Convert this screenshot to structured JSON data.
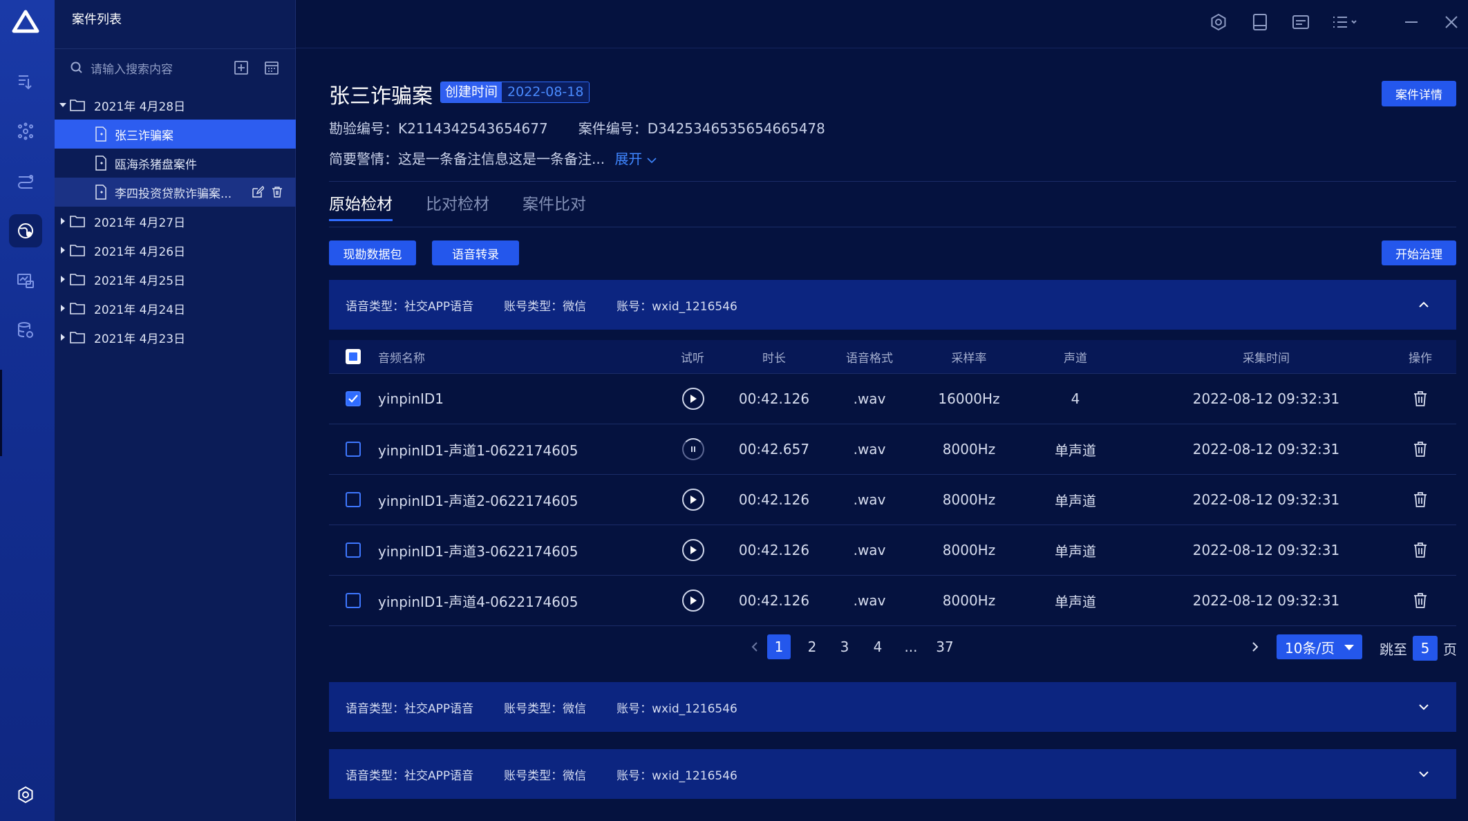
{
  "app": {
    "panel_title": "案件列表",
    "search_placeholder": "请输入搜索内容"
  },
  "rail": {
    "items": [
      "list-icon",
      "cluster-icon",
      "flow-icon",
      "globe-user-icon",
      "chart-monitor-icon",
      "database-icon"
    ],
    "active_index": 3,
    "bottom": "settings-icon"
  },
  "tree": {
    "groups": [
      {
        "label": "2021年 4月28日",
        "expanded": true,
        "files": [
          {
            "label": "张三诈骗案",
            "selected": true
          },
          {
            "label": "瓯海杀猪盘案件",
            "selected": false
          },
          {
            "label": "李四投资贷款诈骗案...",
            "selected": false,
            "hover": true
          }
        ]
      },
      {
        "label": "2021年 4月27日",
        "expanded": false
      },
      {
        "label": "2021年 4月26日",
        "expanded": false
      },
      {
        "label": "2021年 4月25日",
        "expanded": false
      },
      {
        "label": "2021年 4月24日",
        "expanded": false
      },
      {
        "label": "2021年 4月23日",
        "expanded": false
      }
    ]
  },
  "case": {
    "title": "张三诈骗案",
    "created_label": "创建时间",
    "created_value": "2022-08-18",
    "detail_button": "案件详情",
    "survey_no": "勘验编号：K2114342543654677",
    "case_no": "案件编号：D34253465356546654 78",
    "summary": "简要警情：这是一条备注信息这是一条备注...",
    "expand_label": "展开"
  },
  "tabs": [
    "原始检材",
    "比对检材",
    "案件比对"
  ],
  "toolbar": {
    "btn_pack": "现勘数据包",
    "btn_transcribe": "语音转录",
    "btn_start": "开始治理"
  },
  "group_header": {
    "voice_type": "语音类型：社交APP语音",
    "account_type": "账号类型：微信",
    "account": "账号：wxid_1216546"
  },
  "table": {
    "headers": {
      "name": "音频名称",
      "listen": "试听",
      "duration": "时长",
      "format": "语音格式",
      "rate": "采样率",
      "channel": "声道",
      "time": "采集时间",
      "op": "操作"
    },
    "rows": [
      {
        "name": "yinpinID1",
        "checked": true,
        "playing": false,
        "duration": "00:42.126",
        "format": ".wav",
        "rate": "16000Hz",
        "channel": "4",
        "time": "2022-08-12 09:32:31"
      },
      {
        "name": "yinpinID1-声道1-0622174605",
        "checked": false,
        "playing": true,
        "duration": "00:42.657",
        "format": ".wav",
        "rate": "8000Hz",
        "channel": "单声道",
        "time": "2022-08-12 09:32:31"
      },
      {
        "name": "yinpinID1-声道2-0622174605",
        "checked": false,
        "playing": false,
        "duration": "00:42.126",
        "format": ".wav",
        "rate": "8000Hz",
        "channel": "单声道",
        "time": "2022-08-12 09:32:31"
      },
      {
        "name": "yinpinID1-声道3-0622174605",
        "checked": false,
        "playing": false,
        "duration": "00:42.126",
        "format": ".wav",
        "rate": "8000Hz",
        "channel": "单声道",
        "time": "2022-08-12 09:32:31"
      },
      {
        "name": "yinpinID1-声道4-0622174605",
        "checked": false,
        "playing": false,
        "duration": "00:42.126",
        "format": ".wav",
        "rate": "8000Hz",
        "channel": "单声道",
        "time": "2022-08-12 09:32:31"
      }
    ]
  },
  "pagination": {
    "pages": [
      "1",
      "2",
      "3",
      "4",
      "...",
      "37"
    ],
    "current": "1",
    "per_page": "10条/页",
    "jump_prefix": "跳至",
    "jump_value": "5",
    "jump_suffix": "页"
  },
  "colors": {
    "accent": "#2457ec",
    "background": "#05123f",
    "panel": "#0c2580"
  }
}
